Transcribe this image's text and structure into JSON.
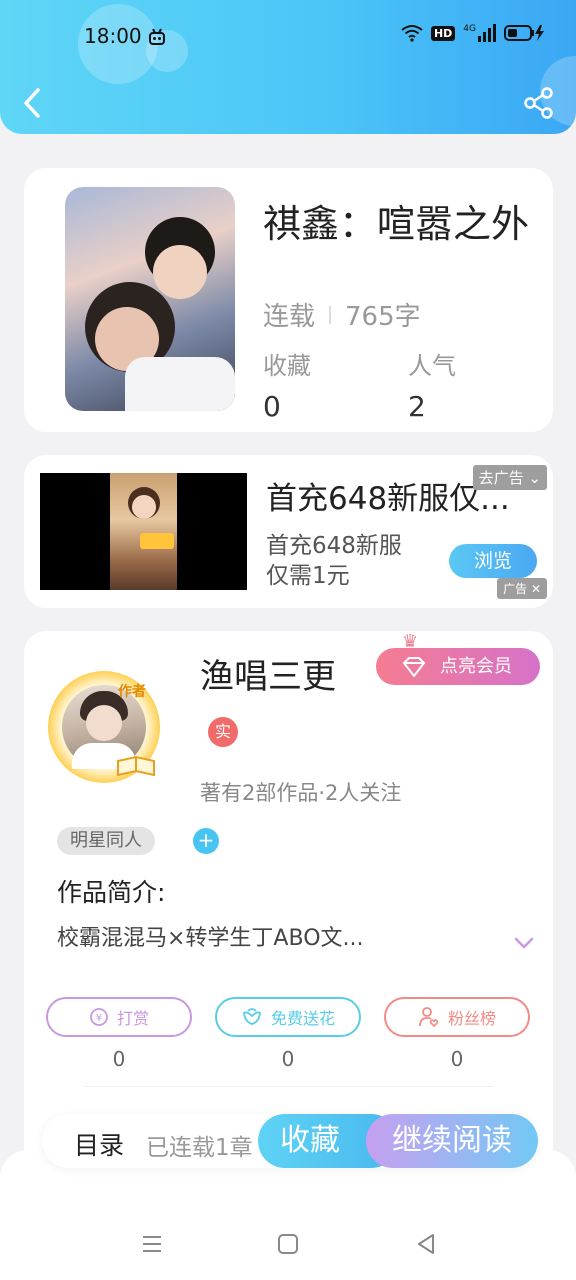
{
  "status_bar": {
    "time": "18:00",
    "hd": "HD",
    "network": "4G"
  },
  "book": {
    "title": "祺鑫：喧嚣之外",
    "status": "连载",
    "word_count": "765字",
    "stats": [
      {
        "label": "收藏",
        "value": "0"
      },
      {
        "label": "人气",
        "value": "2"
      }
    ]
  },
  "ad": {
    "title": "首充648新服仅...",
    "description": "首充648新服仅需1元",
    "close_label": "去广告",
    "browse_label": "浏览",
    "ad_label": "广告"
  },
  "author": {
    "badge": "作者",
    "name": "渔唱三更",
    "vip_label": "点亮会员",
    "real_badge": "实",
    "works": "著有2部作品·2人关注",
    "tag": "明星同人",
    "tag_add": "+",
    "intro_label": "作品简介:",
    "intro_text": "校霸混混马×转学生丁ABO文...",
    "actions": [
      {
        "label": "打赏",
        "count": "0",
        "color": "#c898e0"
      },
      {
        "label": "免费送花",
        "count": "0",
        "color": "#58cde8"
      },
      {
        "label": "粉丝榜",
        "count": "0",
        "color": "#f28b86"
      }
    ]
  },
  "bottom_bar": {
    "toc_label": "目录",
    "toc_status": "已连载1章",
    "collect_label": "收藏",
    "read_label": "继续阅读"
  }
}
